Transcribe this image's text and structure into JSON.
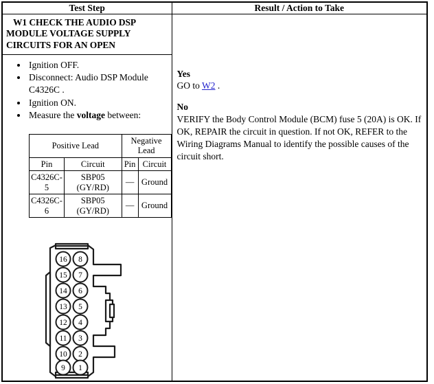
{
  "table": {
    "headers": {
      "test_step": "Test Step",
      "result_action": "Result / Action to Take"
    }
  },
  "test_step": {
    "title": "W1 CHECK THE AUDIO DSP MODULE VOLTAGE SUPPLY CIRCUITS FOR AN OPEN",
    "steps": [
      {
        "text": "Ignition OFF."
      },
      {
        "text": "Disconnect: Audio DSP Module C4326C ."
      },
      {
        "text": "Ignition ON."
      },
      {
        "pre": "Measure the ",
        "bold": "voltage",
        "post": " between:"
      }
    ],
    "lead_table": {
      "group_headers": {
        "positive": "Positive Lead",
        "negative": "Negative Lead"
      },
      "column_headers": {
        "pos_pin": "Pin",
        "pos_circuit": "Circuit",
        "neg_pin": "Pin",
        "neg_circuit": "Circuit"
      },
      "rows": [
        {
          "pos_pin": "C4326C-5",
          "pos_circuit": "SBP05 (GY/RD)",
          "neg_pin": "—",
          "neg_circuit": "Ground"
        },
        {
          "pos_pin": "C4326C-6",
          "pos_circuit": "SBP05 (GY/RD)",
          "neg_pin": "—",
          "neg_circuit": "Ground"
        }
      ]
    },
    "connector": {
      "name": "audio-dsp-module-connector-c4326c",
      "pin_count": 16,
      "left_column_pins": [
        "16",
        "15",
        "14",
        "13",
        "12",
        "11",
        "10",
        "9"
      ],
      "right_column_pins": [
        "8",
        "7",
        "6",
        "5",
        "4",
        "3",
        "2",
        "1"
      ]
    }
  },
  "result_action": {
    "yes_label": "Yes",
    "yes_text_before": "GO to ",
    "yes_link": "W2",
    "yes_text_after": " .",
    "no_label": "No",
    "no_text": "VERIFY the Body Control Module (BCM) fuse 5 (20A) is OK. If OK, REPAIR the circuit in question. If not OK, REFER to the Wiring Diagrams Manual to identify the possible causes of the circuit short."
  },
  "colors": {
    "border": "#000000",
    "link": "#2222cc",
    "background": "#ffffff"
  }
}
